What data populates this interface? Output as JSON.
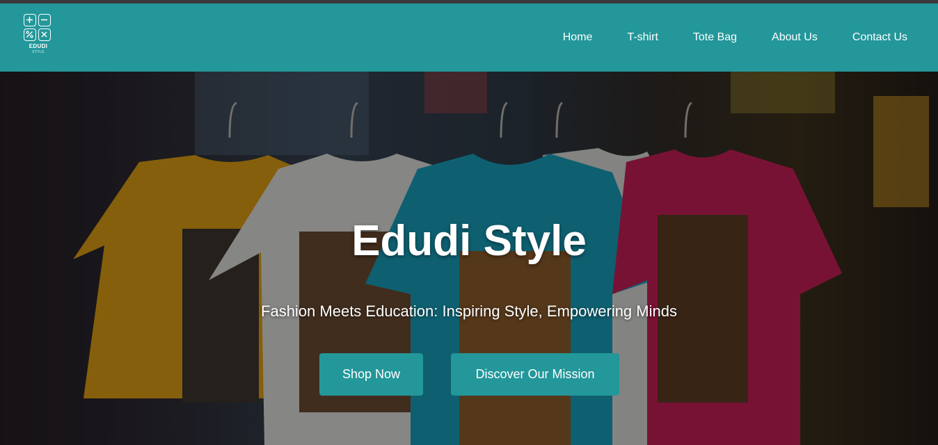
{
  "brand": {
    "name": "EDUDI",
    "tagline": "STYLE",
    "accent_color": "#23979a"
  },
  "nav": {
    "items": [
      {
        "label": "Home"
      },
      {
        "label": "T-shirt"
      },
      {
        "label": "Tote Bag"
      },
      {
        "label": "About Us"
      },
      {
        "label": "Contact Us"
      }
    ]
  },
  "hero": {
    "title": "Edudi Style",
    "subtitle": "Fashion Meets Education: Inspiring Style, Empowering Minds",
    "primary_button": "Shop Now",
    "secondary_button": "Discover Our Mission",
    "image_subject": "row of colorful printed t-shirts on hangers"
  }
}
